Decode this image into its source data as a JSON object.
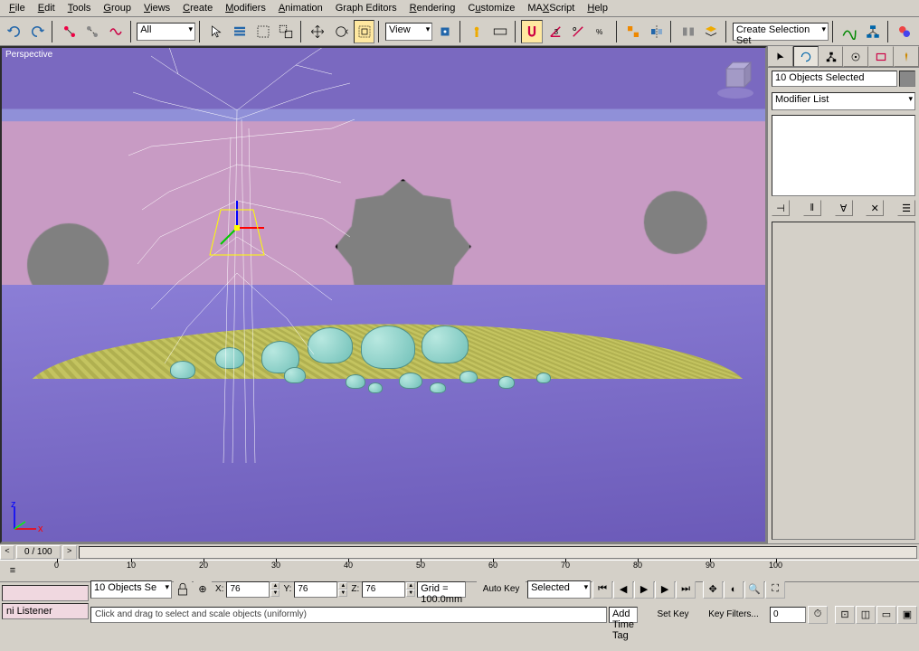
{
  "menu": {
    "file": "File",
    "edit": "Edit",
    "tools": "Tools",
    "group": "Group",
    "views": "Views",
    "create": "Create",
    "modifiers": "Modifiers",
    "animation": "Animation",
    "grapheditors": "Graph Editors",
    "rendering": "Rendering",
    "customize": "Customize",
    "maxscript": "MAXScript",
    "help": "Help"
  },
  "toolbar": {
    "filter": "All",
    "refcoord": "View",
    "selset": "Create Selection Set"
  },
  "viewport": {
    "label": "Perspective"
  },
  "panel": {
    "selection": "10 Objects Selected",
    "modlist": "Modifier List"
  },
  "timeline": {
    "frame": "0 / 100",
    "ticks": [
      "0",
      "10",
      "20",
      "30",
      "40",
      "50",
      "60",
      "70",
      "80",
      "90",
      "100"
    ]
  },
  "status": {
    "listener": "ni Listener",
    "selinfo": "10 Objects Se",
    "x": "76",
    "y": "76",
    "z": "76",
    "grid": "Grid = 100.0mm",
    "timetag": "Add Time Tag",
    "autokey": "Auto Key",
    "setkey": "Set Key",
    "keyfilters": "Key Filters...",
    "keymode": "Selected",
    "prompt": "Click and drag to select and scale objects (uniformly)"
  }
}
